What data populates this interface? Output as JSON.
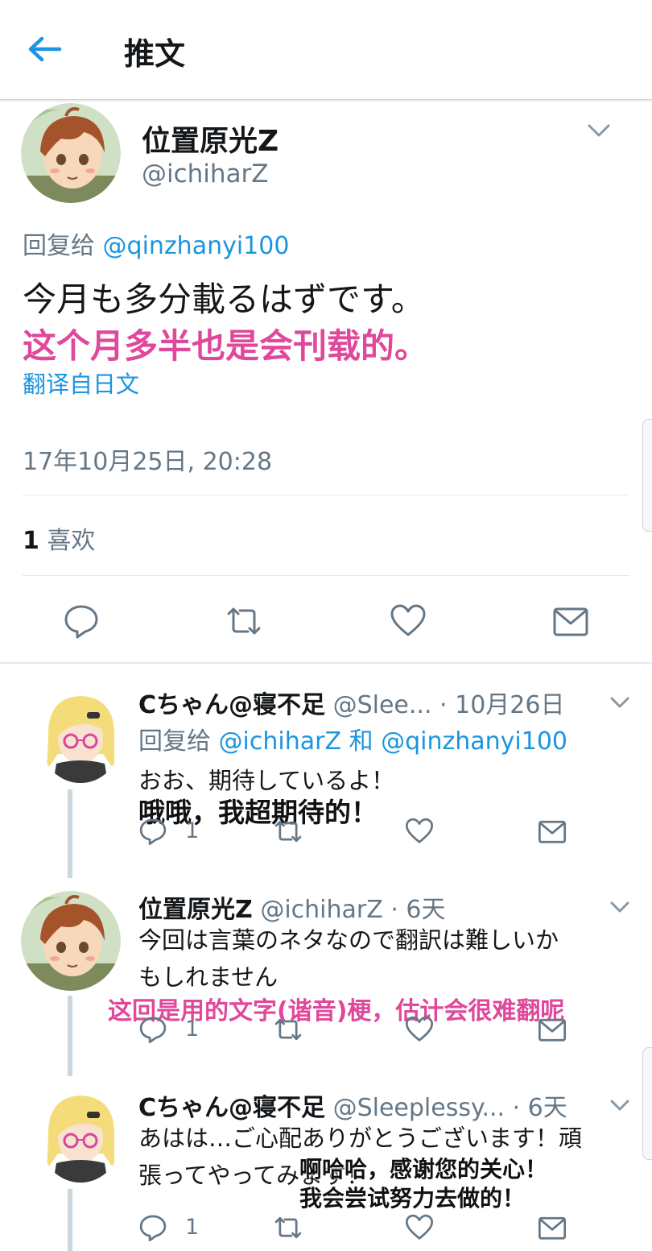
{
  "header": {
    "title": "推文",
    "back_icon": "arrow-left-icon"
  },
  "main_tweet": {
    "display_name": "位置原光Z",
    "handle": "@ichiharZ",
    "reply_prefix": "回复给",
    "reply_to": "@qinzhanyi100",
    "text": "今月も多分載るはずです。",
    "translation_overlay": "这个月多半也是会刊载的。",
    "translate_link": "翻译自日文",
    "timestamp": "17年10月25日, 20:28",
    "likes_count": "1",
    "likes_label": "喜欢"
  },
  "replies": [
    {
      "display_name": "Cちゃん@寝不足",
      "handle": "@Slee...",
      "time": "· 10月26日",
      "reply_prefix": "回复给",
      "reply_to_1": "@ichiharZ",
      "reply_and": "和",
      "reply_to_2": "@qinzhanyi100",
      "text": "おお、期待しているよ！",
      "overlay": "哦哦，我超期待的！",
      "reply_count": "1"
    },
    {
      "display_name": "位置原光Z",
      "handle": "@ichiharZ",
      "time": "· 6天",
      "text_line1": "今回は言葉のネタなので翻訳は難しいか",
      "text_line2": "もしれません",
      "overlay": "这回是用的文字(谐音)梗，估计会很难翻呢",
      "reply_count": "1"
    },
    {
      "display_name": "Cちゃん@寝不足",
      "handle": "@Sleeplessy...",
      "time": "· 6天",
      "text_line1": "あはは…ご心配ありがとうございます！頑",
      "text_line2": "張ってやってみます！",
      "overlay_line1": "啊哈哈，感谢您的关心！",
      "overlay_line2": "我会尝试努力去做的！",
      "reply_count": "1"
    }
  ],
  "colors": {
    "accent": "#1b95e0",
    "pink_overlay": "#e0489b",
    "grey": "#657786"
  }
}
